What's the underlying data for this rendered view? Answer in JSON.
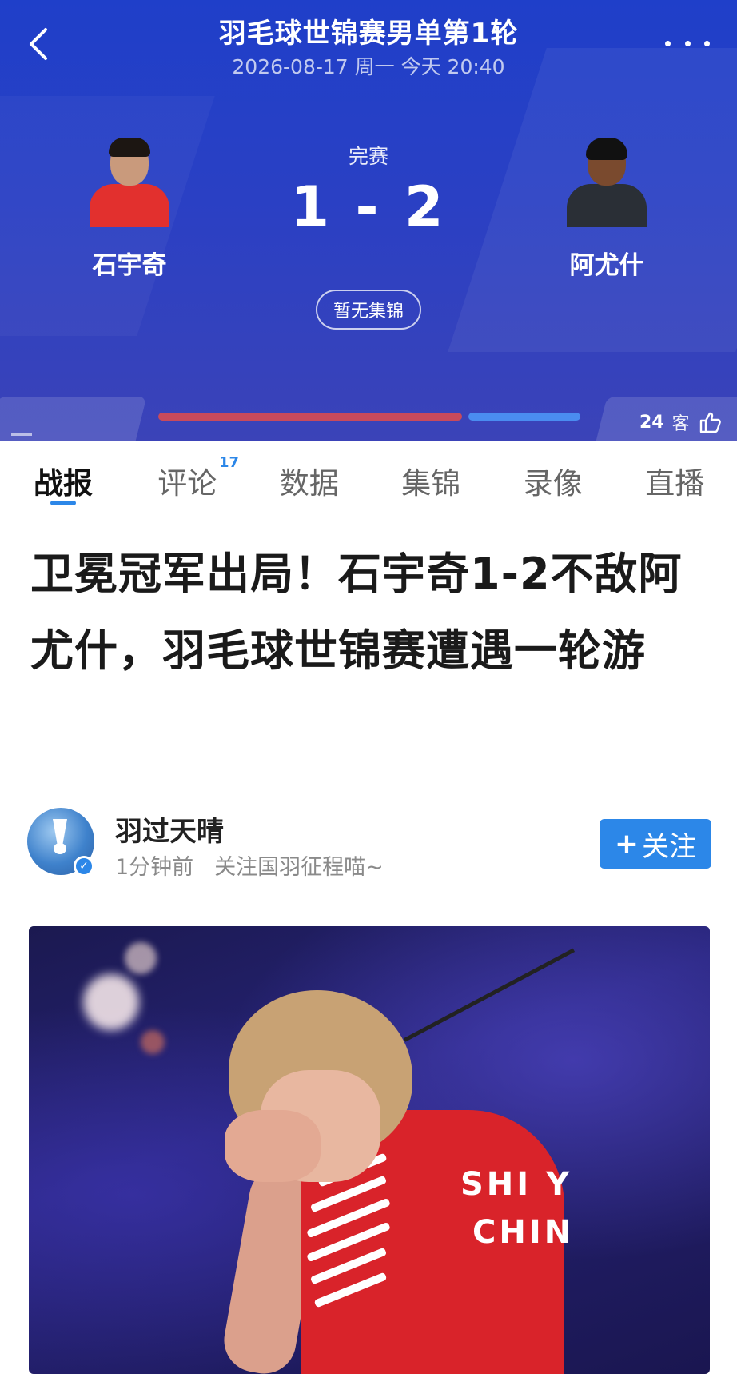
{
  "header": {
    "title": "羽毛球世锦赛男单第1轮",
    "datetime": "2026-08-17 周一 今天 20:40",
    "status": "完赛",
    "score": "1 - 2",
    "highlight_button": "暂无集锦",
    "left_player": {
      "name": "石宇奇"
    },
    "right_player": {
      "name": "阿尤什"
    },
    "support_share_left": 0.72,
    "support_count": "24",
    "support_label": "客",
    "colors": {
      "left_bar": "#c84a5c",
      "right_bar": "#4a8cf0",
      "background": "#2a40c4"
    }
  },
  "tabs": [
    {
      "label": "战报",
      "active": true
    },
    {
      "label": "评论",
      "badge": "17"
    },
    {
      "label": "数据"
    },
    {
      "label": "集锦"
    },
    {
      "label": "录像"
    },
    {
      "label": "直播"
    }
  ],
  "article": {
    "headline": "卫冕冠军出局！石宇奇1-2不敌阿尤什，羽毛球世锦赛遭遇一轮游",
    "author": {
      "name": "羽过天晴",
      "time": "1分钟前",
      "bio": "关注国羽征程喵~",
      "follow_label": "关注"
    },
    "photo": {
      "jersey_line1": "SHI Y",
      "jersey_line2": "CHIN"
    }
  },
  "icons": [
    "back-arrow-icon",
    "more-dots-icon",
    "thumb-up-icon",
    "verified-icon",
    "plus-icon"
  ]
}
